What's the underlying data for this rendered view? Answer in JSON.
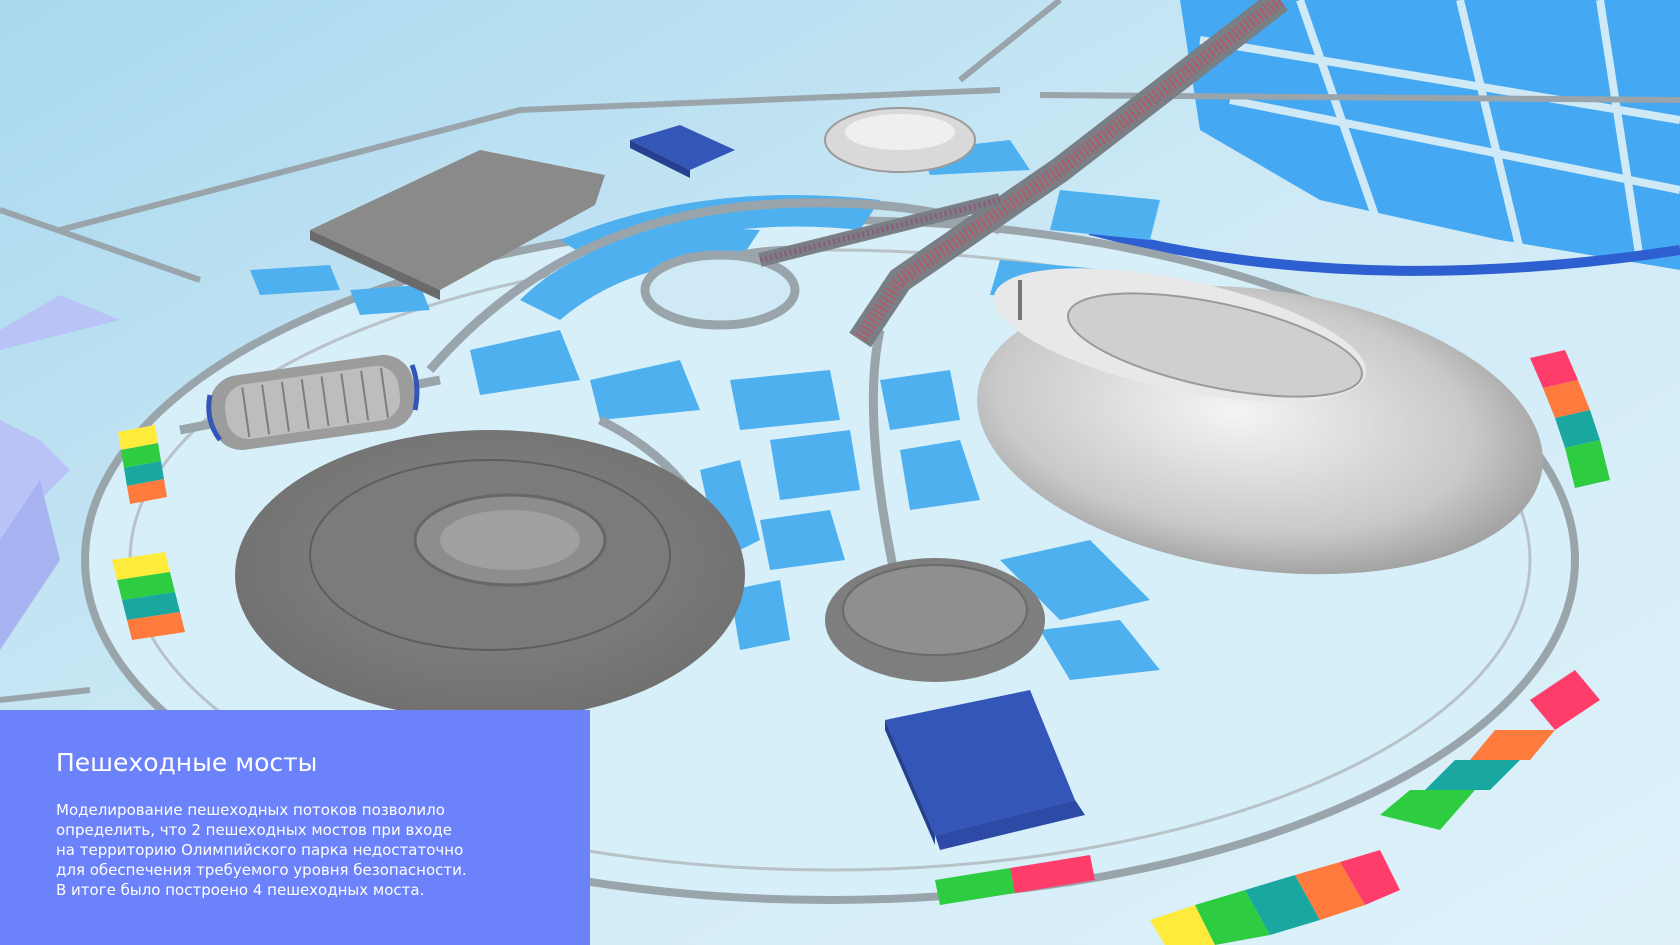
{
  "panel": {
    "title": "Пешеходные мосты",
    "text": "Моделирование пешеходных потоков позволило\nопределить, что 2 пешеходных мостов при входе\nна территорию Олимпийского парка недостаточно\nдля обеспечения требуемого уровня безопасности.\nВ итоге было построено 4 пешеходных моста."
  },
  "scene": {
    "description_icon": "3d-olympic-park-model",
    "colors": {
      "background": "#bfe3f2",
      "ground": "#d4eef8",
      "water_zones": "#4fb0f0",
      "roads": "#9aa4ab",
      "buildings": "#8e8e8e",
      "blue_arena": "#3456b8",
      "panel": "#6b82fb",
      "level_colors": [
        "#ffeb3b",
        "#2ecc40",
        "#1aa7a0",
        "#ff7a3d",
        "#ff3d6b"
      ]
    }
  }
}
